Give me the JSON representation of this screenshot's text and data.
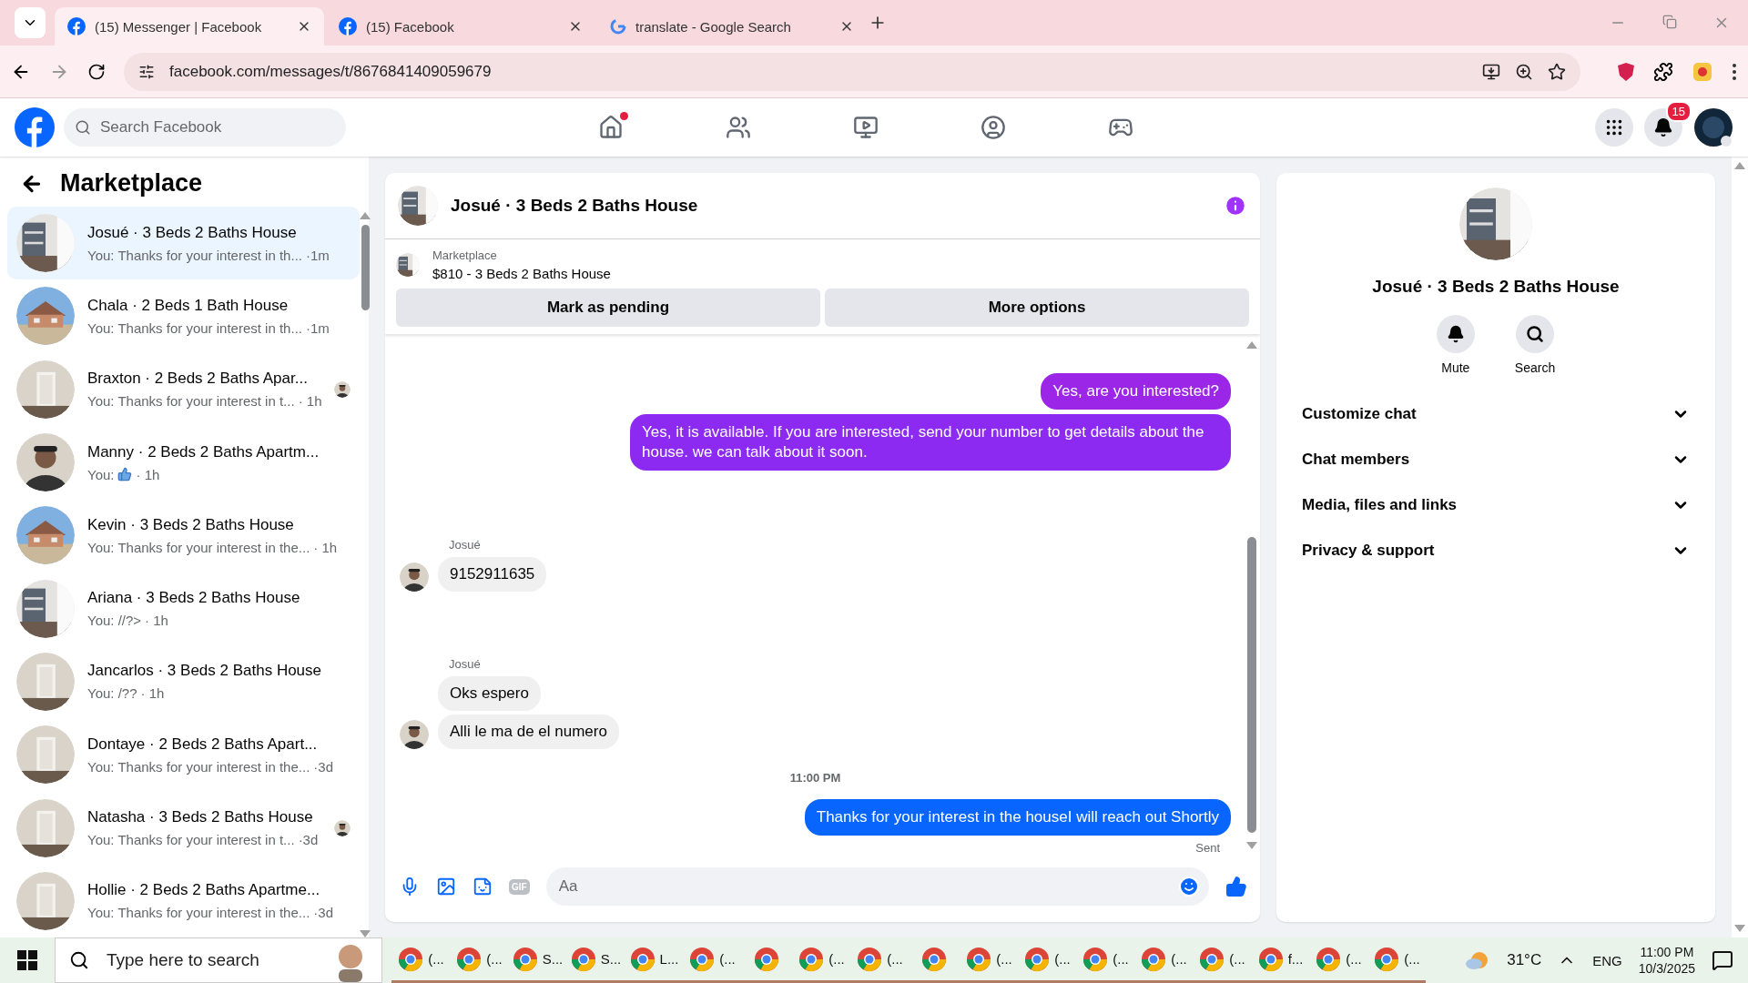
{
  "browser": {
    "tabs": [
      {
        "title": "(15) Messenger | Facebook",
        "selected": true
      },
      {
        "title": "(15) Facebook",
        "selected": false
      },
      {
        "title": "translate - Google Search",
        "selected": false
      }
    ],
    "url": "facebook.com/messages/t/8676841409059679"
  },
  "facebook": {
    "search_placeholder": "Search Facebook",
    "notification_count": "15"
  },
  "sidebar": {
    "title": "Marketplace",
    "conversations": [
      {
        "name": "Josué · 3 Beds 2 Baths House",
        "preview": "You: Thanks for your interest in th...",
        "time": "·1m",
        "selected": true
      },
      {
        "name": "Chala · 2 Beds 1 Bath House",
        "preview": "You: Thanks for your interest in th...",
        "time": "·1m",
        "selected": false
      },
      {
        "name": "Braxton · 2 Beds 2 Baths Apar...",
        "preview": "You: Thanks for your interest in t...",
        "time": "· 1h",
        "seen": true,
        "selected": false
      },
      {
        "name": "Manny · 2 Beds 2 Baths Apartm...",
        "preview": "You:",
        "time": "· 1h",
        "like": true,
        "selected": false
      },
      {
        "name": "Kevin · 3 Beds 2 Baths House",
        "preview": "You: Thanks for your interest in the...",
        "time": "· 1h",
        "selected": false
      },
      {
        "name": "Ariana · 3 Beds 2 Baths House",
        "preview": "You: //?>",
        "time": "· 1h",
        "selected": false
      },
      {
        "name": "Jancarlos · 3 Beds 2 Baths House",
        "preview": "You: /??",
        "time": "· 1h",
        "selected": false
      },
      {
        "name": "Dontaye · 2 Beds 2 Baths Apart...",
        "preview": "You: Thanks for your interest in the...",
        "time": "·3d",
        "selected": false
      },
      {
        "name": "Natasha · 3 Beds 2 Baths House",
        "preview": "You: Thanks for your interest in t...",
        "time": "·3d",
        "seen": true,
        "selected": false
      },
      {
        "name": "Hollie · 2 Beds 2 Baths Apartme...",
        "preview": "You: Thanks for your interest in the...",
        "time": "·3d",
        "selected": false
      }
    ]
  },
  "chat": {
    "title": "Josué · 3 Beds 2 Baths House",
    "listing": {
      "source": "Marketplace",
      "item": "$810 - 3 Beds 2 Baths House"
    },
    "actions": [
      "Mark as pending",
      "More options"
    ],
    "messages": [
      {
        "kind": "outgoing",
        "text": "Yes, are you interested?",
        "color": "#9b26e8"
      },
      {
        "kind": "outgoing",
        "text": "Yes, it is available. If you are interested, send your number to get details about the house. we can talk about it soon.",
        "color": "#8c2af2"
      },
      {
        "kind": "incoming",
        "sender": "Josué",
        "texts": [
          "9152911635"
        ]
      },
      {
        "kind": "incoming",
        "sender": "Josué",
        "texts": [
          "Oks espero",
          "Alli le ma de el numero"
        ]
      },
      {
        "kind": "time",
        "text": "11:00 PM"
      },
      {
        "kind": "outgoing",
        "text": "Thanks for your interest in the houseI will reach out Shortly",
        "color": "#0866ff",
        "status": "Sent"
      }
    ],
    "composer": {
      "placeholder": "Aa",
      "gif_label": "GIF"
    }
  },
  "details": {
    "name": "Josué · 3 Beds 2 Baths House",
    "actions": [
      {
        "kind": "mute",
        "label": "Mute"
      },
      {
        "kind": "search",
        "label": "Search"
      }
    ],
    "sections": [
      {
        "label": "Customize chat",
        "expanded": false
      },
      {
        "label": "Chat members",
        "expanded": false
      },
      {
        "label": "Media, files and links",
        "expanded": false
      },
      {
        "label": "Privacy & support",
        "expanded": false
      }
    ]
  },
  "taskbar": {
    "search_placeholder": "Type here to search",
    "apps": [
      {
        "label": "(..."
      },
      {
        "label": "(..."
      },
      {
        "label": "S..."
      },
      {
        "label": "S..."
      },
      {
        "label": "L..."
      },
      {
        "label": "(..."
      },
      {
        "kind": "icon_only"
      },
      {
        "label": "(..."
      },
      {
        "label": "(..."
      },
      {
        "kind": "icon_only"
      },
      {
        "label": "(..."
      },
      {
        "label": "(..."
      },
      {
        "label": "(..."
      },
      {
        "label": "(..."
      },
      {
        "label": "(..."
      },
      {
        "label": "f..."
      },
      {
        "label": "(..."
      },
      {
        "label": "(..."
      }
    ],
    "temperature": "31°C",
    "language": "ENG",
    "time": "11:00 PM",
    "date": "10/3/2025"
  }
}
